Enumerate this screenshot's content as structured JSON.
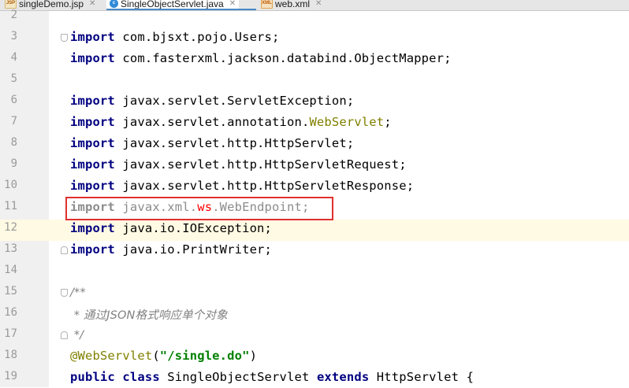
{
  "tabs": [
    {
      "label": "singleDemo.jsp",
      "icon": "jsp-file-icon",
      "icon_text": "JSP"
    },
    {
      "label": "SingleObjectServlet.java",
      "icon": "java-class-icon",
      "icon_text": "c",
      "active": true
    },
    {
      "label": "web.xml",
      "icon": "xml-file-icon",
      "icon_text": "XML"
    }
  ],
  "editor": {
    "lines": [
      {
        "n": "2",
        "segments": []
      },
      {
        "n": "3",
        "fold": "start",
        "segments": [
          {
            "t": "import",
            "c": "kw"
          },
          {
            "t": " com.bjsxt.pojo.Users;"
          }
        ]
      },
      {
        "n": "4",
        "segments": [
          {
            "t": "import",
            "c": "kw"
          },
          {
            "t": " com.fasterxml.jackson.databind.ObjectMapper;"
          }
        ]
      },
      {
        "n": "5",
        "segments": []
      },
      {
        "n": "6",
        "segments": [
          {
            "t": "import",
            "c": "kw"
          },
          {
            "t": " javax.servlet.ServletException;"
          }
        ]
      },
      {
        "n": "7",
        "segments": [
          {
            "t": "import",
            "c": "kw"
          },
          {
            "t": " javax.servlet.annotation."
          },
          {
            "t": "WebServlet",
            "c": "ann"
          },
          {
            "t": ";"
          }
        ]
      },
      {
        "n": "8",
        "segments": [
          {
            "t": "import",
            "c": "kw"
          },
          {
            "t": " javax.servlet.http.HttpServlet;"
          }
        ]
      },
      {
        "n": "9",
        "segments": [
          {
            "t": "import",
            "c": "kw"
          },
          {
            "t": " javax.servlet.http.HttpServletRequest;"
          }
        ]
      },
      {
        "n": "10",
        "segments": [
          {
            "t": "import",
            "c": "kw"
          },
          {
            "t": " javax.servlet.http.HttpServletResponse;"
          }
        ]
      },
      {
        "n": "11",
        "unused": true,
        "segments": [
          {
            "t": "import",
            "c": "kw"
          },
          {
            "t": " javax.xml."
          },
          {
            "t": "ws",
            "c": "err"
          },
          {
            "t": ".WebEndpoint;"
          }
        ]
      },
      {
        "n": "12",
        "current": true,
        "segments": [
          {
            "t": "import",
            "c": "kw"
          },
          {
            "t": " java.io.IOException;"
          }
        ]
      },
      {
        "n": "13",
        "fold": "end",
        "segments": [
          {
            "t": "import",
            "c": "kw"
          },
          {
            "t": " java.io.PrintWriter;"
          }
        ]
      },
      {
        "n": "14",
        "segments": []
      },
      {
        "n": "15",
        "fold": "start",
        "segments": [
          {
            "t": "/**",
            "c": "cmt"
          }
        ]
      },
      {
        "n": "16",
        "segments": [
          {
            "t": " * 通过JSON格式响应单个对象",
            "c": "cmt"
          }
        ]
      },
      {
        "n": "17",
        "fold": "end",
        "segments": [
          {
            "t": " */",
            "c": "cmt"
          }
        ]
      },
      {
        "n": "18",
        "segments": [
          {
            "t": "@WebServlet",
            "c": "ann"
          },
          {
            "t": "("
          },
          {
            "t": "\"/single.do\"",
            "c": "str"
          },
          {
            "t": ")"
          }
        ]
      },
      {
        "n": "19",
        "segments": [
          {
            "t": "public",
            "c": "kw"
          },
          {
            "t": " "
          },
          {
            "t": "class",
            "c": "kw"
          },
          {
            "t": " SingleObjectServlet "
          },
          {
            "t": "extends",
            "c": "kw"
          },
          {
            "t": " HttpServlet {"
          }
        ]
      }
    ]
  },
  "colors": {
    "keyword": "#000080",
    "annotation": "#808000",
    "string": "#008000",
    "error": "#ff0000",
    "highlight_box": "#e0302f",
    "current_line": "#fffae3"
  }
}
